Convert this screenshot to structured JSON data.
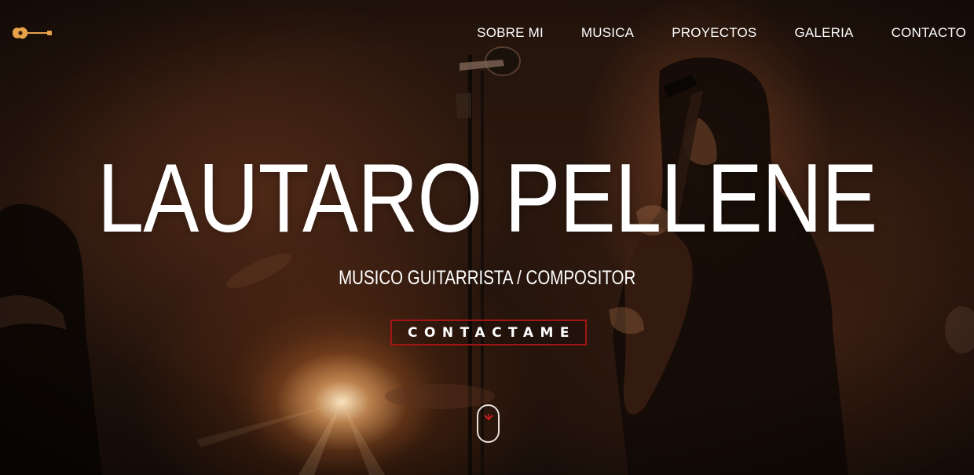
{
  "nav": {
    "items": [
      {
        "label": "SOBRE MI"
      },
      {
        "label": "MUSICA"
      },
      {
        "label": "PROYECTOS"
      },
      {
        "label": "GALERIA"
      },
      {
        "label": "CONTACTO"
      }
    ]
  },
  "hero": {
    "title": "LAUTARO PELLENE",
    "subtitle": "MUSICO GUITARRISTA / COMPOSITOR",
    "cta_label": "CONTACTAME"
  },
  "icons": {
    "logo": "guitar-logo-icon",
    "scroll": "mouse-scroll-icon"
  },
  "colors": {
    "accent": "#a41515",
    "logo": "#e8a24a",
    "text": "#ffffff"
  }
}
